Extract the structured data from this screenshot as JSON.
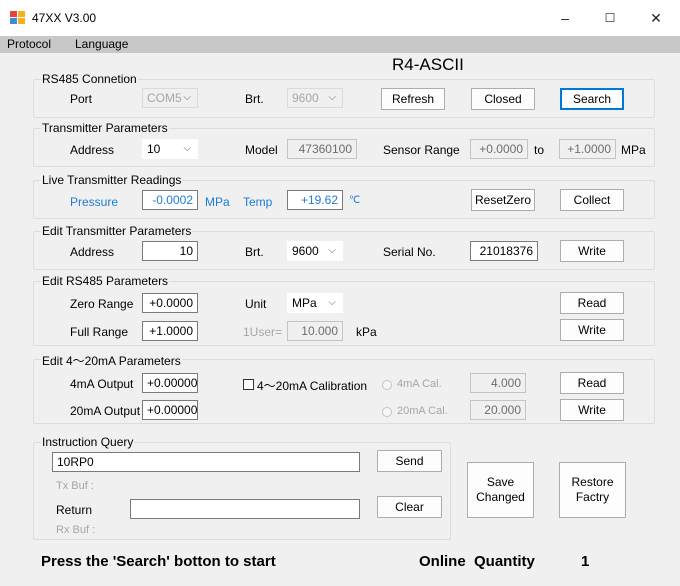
{
  "window": {
    "title": "47XX V3.00",
    "minimize": "–",
    "maximize": "☐",
    "close": "✕",
    "icon": "app-window-icon"
  },
  "menu": [
    "Protocol",
    "Language"
  ],
  "mode_label": "R4-ASCII",
  "rs485": {
    "title": "RS485 Connetion",
    "port_label": "Port",
    "port_value": "COM5",
    "brt_label": "Brt.",
    "brt_value": "9600",
    "refresh": "Refresh",
    "closed": "Closed",
    "search": "Search"
  },
  "transmitter": {
    "title": "Transmitter Parameters",
    "address_label": "Address",
    "address_value": "10",
    "model_label": "Model",
    "model_value": "47360100",
    "range_label": "Sensor Range",
    "range_min": "+0.0000",
    "to": "to",
    "range_max": "+1.0000",
    "unit": "MPa"
  },
  "live": {
    "title": "Live Transmitter Readings",
    "pressure_label": "Pressure",
    "pressure_value": "-0.0002",
    "pressure_unit": "MPa",
    "temp_label": "Temp",
    "temp_value": "+19.62",
    "temp_unit": "℃",
    "reset_zero": "ResetZero",
    "collect": "Collect"
  },
  "edit_transmitter": {
    "title": "Edit Transmitter Parameters",
    "address_label": "Address",
    "address_value": "10",
    "brt_label": "Brt.",
    "brt_value": "9600",
    "serial_label": "Serial No.",
    "serial_value": "21018376",
    "write": "Write"
  },
  "edit_rs485": {
    "title": "Edit RS485 Parameters",
    "zero_label": "Zero Range",
    "zero_value": "+0.0000",
    "unit_label": "Unit",
    "unit_value": "MPa",
    "read": "Read",
    "full_label": "Full Range",
    "full_value": "+1.0000",
    "user_label": "1User=",
    "user_value": "10.000",
    "user_unit": "kPa",
    "write": "Write"
  },
  "edit_ma": {
    "title": "Edit 4～20mA Parameters",
    "ma4_label": "4mA Output",
    "ma4_value": "+0.00000",
    "calibration_label": "4～20mA Calibration",
    "ma4_cal_label": "4mA Cal.",
    "ma4_cal_value": "4.000",
    "read": "Read",
    "ma20_label": "20mA Output",
    "ma20_value": "+0.00000",
    "ma20_cal_label": "20mA Cal.",
    "ma20_cal_value": "20.000",
    "write": "Write"
  },
  "query": {
    "title": "Instruction Query",
    "command_value": "10RP0",
    "send": "Send",
    "tx_label": "Tx Buf :",
    "return_label": "Return",
    "return_value": "",
    "clear": "Clear",
    "rx_label": "Rx Buf :"
  },
  "save_changed": [
    "Save",
    "Changed"
  ],
  "restore_factry": [
    "Restore",
    "Factry"
  ],
  "status": {
    "message": "Press the 'Search' botton to start",
    "online_label": "Online",
    "quantity_label": "Quantity",
    "quantity_value": "1"
  }
}
